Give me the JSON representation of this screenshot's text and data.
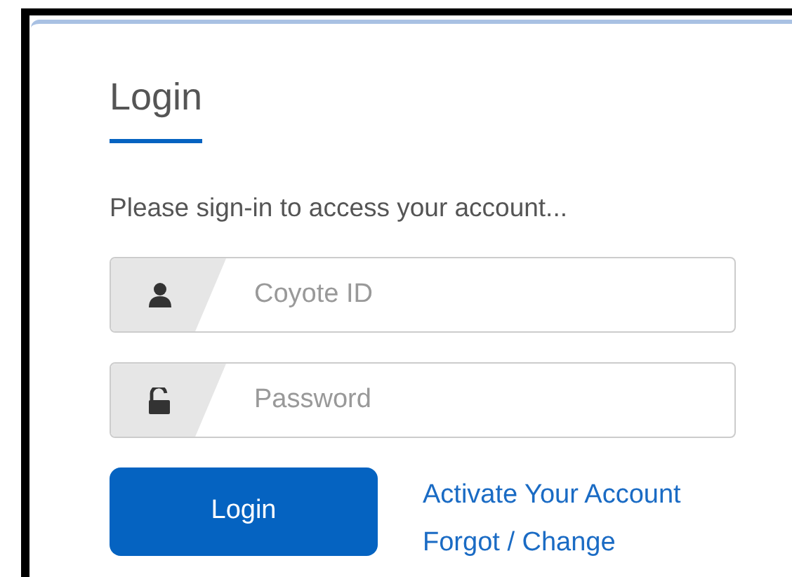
{
  "card": {
    "title": "Login",
    "subtitle": "Please sign-in to access your account..."
  },
  "fields": [
    {
      "kind": "user",
      "placeholder": "Coyote ID"
    },
    {
      "kind": "lock",
      "placeholder": "Password"
    }
  ],
  "submit": {
    "label": "Login"
  },
  "links": [
    "Activate Your Account",
    "Forgot / Change"
  ]
}
